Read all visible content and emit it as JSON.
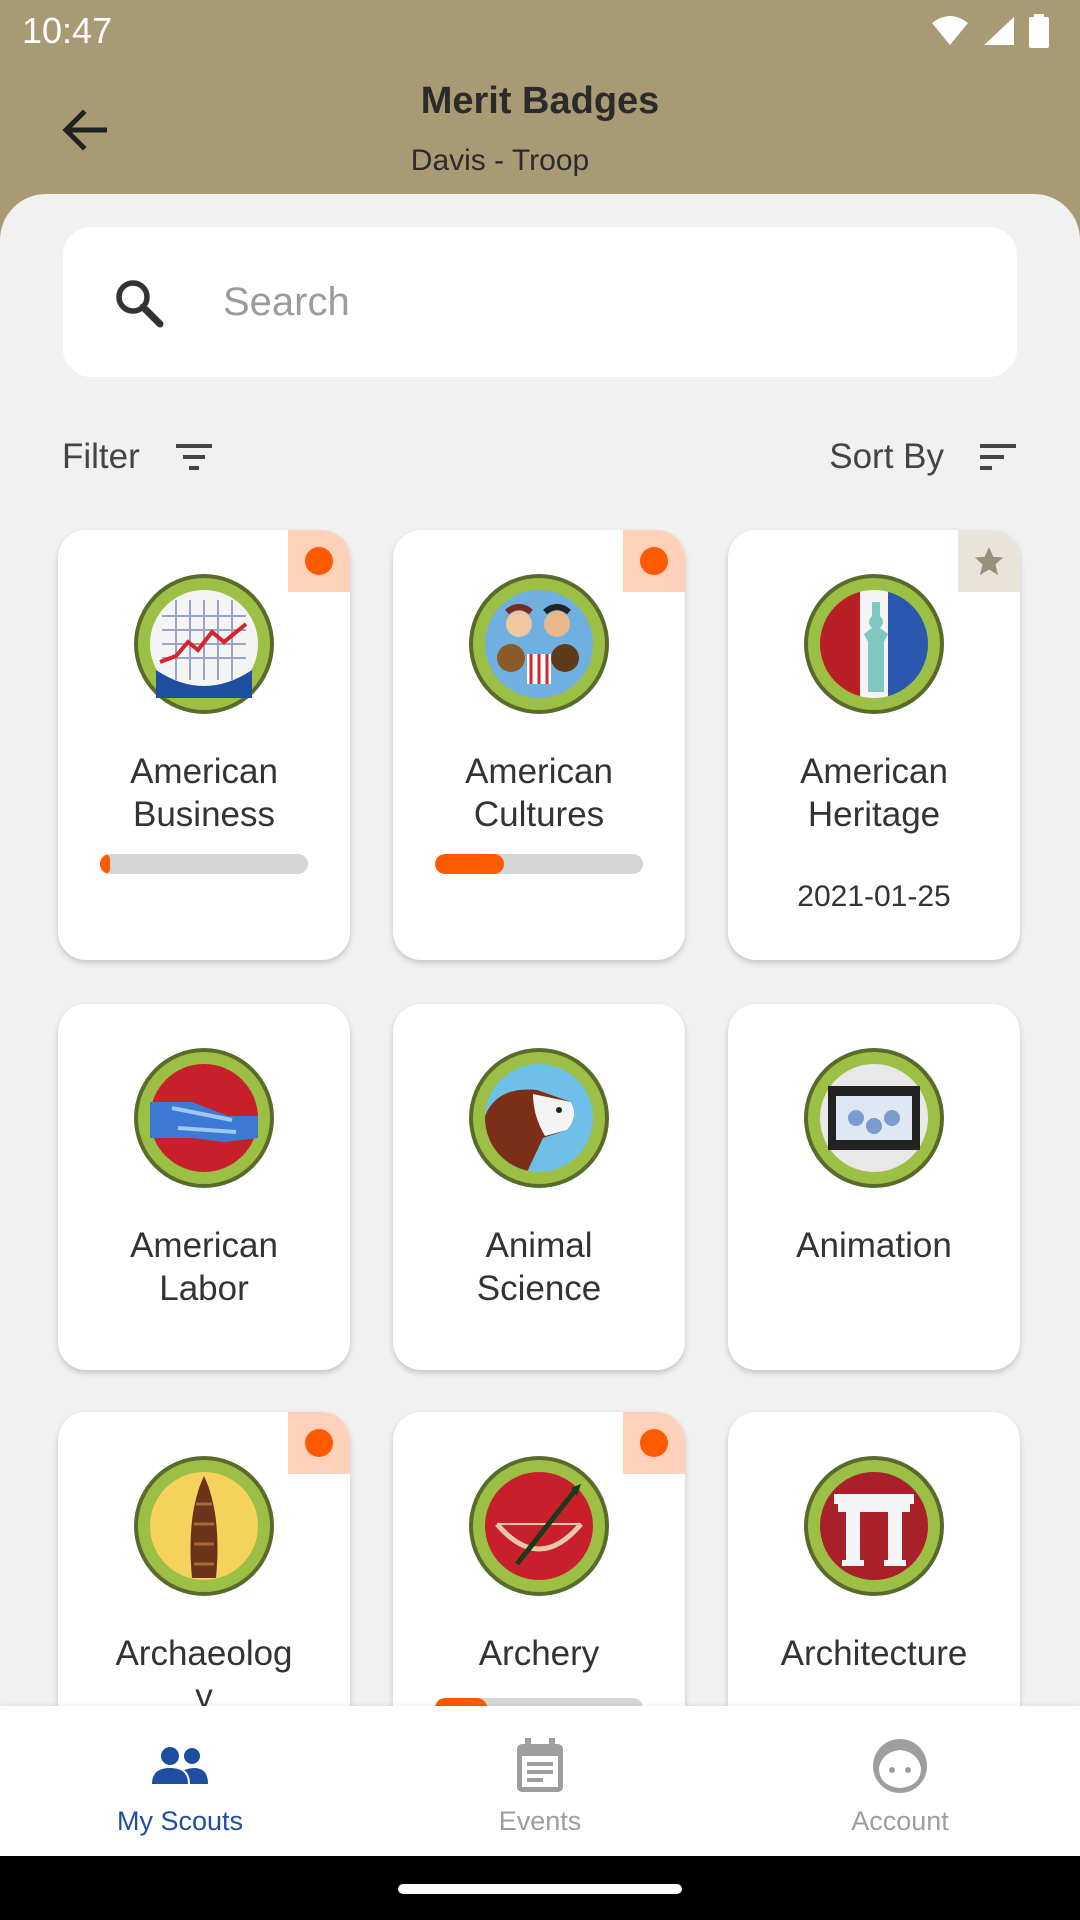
{
  "status_bar": {
    "time": "10:47"
  },
  "header": {
    "title": "Merit Badges",
    "subtitle": "Davis - Troop"
  },
  "search": {
    "placeholder": "Search",
    "value": ""
  },
  "filter": {
    "label": "Filter"
  },
  "sort": {
    "label": "Sort By"
  },
  "colors": {
    "accent": "#ff5a00",
    "header_bg": "#a89a74",
    "nav_active": "#1e4e9f",
    "badge_border": "#8fb33a"
  },
  "badges": [
    {
      "name_line1": "American",
      "name_line2": "Business",
      "status": "in-progress",
      "progress": 0.05,
      "icon": "chart-badge-icon"
    },
    {
      "name_line1": "American",
      "name_line2": "Cultures",
      "status": "in-progress",
      "progress": 0.33,
      "icon": "faces-badge-icon"
    },
    {
      "name_line1": "American",
      "name_line2": "Heritage",
      "status": "completed",
      "date": "2021-01-25",
      "icon": "liberty-badge-icon"
    },
    {
      "name_line1": "American",
      "name_line2": "Labor",
      "status": "none",
      "icon": "handshake-badge-icon"
    },
    {
      "name_line1": "Animal",
      "name_line2": "Science",
      "status": "none",
      "icon": "cow-badge-icon"
    },
    {
      "name_line1": "Animation",
      "name_line2": "",
      "status": "none",
      "icon": "film-badge-icon"
    },
    {
      "name_line1": "Archaeolog",
      "name_line2": "y",
      "status": "in-progress",
      "icon": "artifact-badge-icon"
    },
    {
      "name_line1": "Archery",
      "name_line2": "",
      "status": "in-progress",
      "progress": 0.25,
      "icon": "bow-badge-icon"
    },
    {
      "name_line1": "Architecture",
      "name_line2": "",
      "status": "none",
      "icon": "columns-badge-icon"
    }
  ],
  "nav": {
    "my_scouts": "My Scouts",
    "events": "Events",
    "account": "Account"
  }
}
